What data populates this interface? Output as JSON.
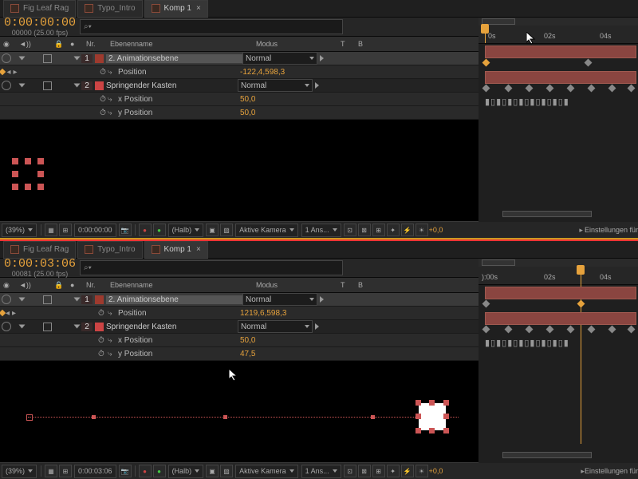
{
  "tabs": [
    {
      "label": "Fig Leaf Rag"
    },
    {
      "label": "Typo_Intro"
    },
    {
      "label": "Komp 1",
      "active": true
    }
  ],
  "top": {
    "timecode": "0:00:00:00",
    "frame": "00000 (25.00 fps)",
    "search_ph": "⌕▾",
    "colNr": "Nr.",
    "colLayer": "Ebenenname",
    "colMode": "Modus",
    "colT": "T",
    "colB": "B",
    "layer1": {
      "nr": "1",
      "name": "2. Animationsebene",
      "mode": "Normal",
      "pos_lbl": "Position",
      "pos_val": "-122,4,598,3"
    },
    "layer2": {
      "nr": "2",
      "name": "Springender Kasten",
      "mode": "Normal",
      "xp_lbl": "x Position",
      "xp_val": "50,0",
      "yp_lbl": "y Position",
      "yp_val": "50,0"
    },
    "ruler": {
      "t0": "0s",
      "t2": "02s",
      "t4": "04s"
    }
  },
  "bottom": {
    "timecode": "0:00:03:06",
    "frame": "00081 (25.00 fps)",
    "layer1": {
      "nr": "1",
      "name": "2. Animationsebene",
      "mode": "Normal",
      "pos_lbl": "Position",
      "pos_val": "1219,6,598,3"
    },
    "layer2": {
      "nr": "2",
      "name": "Springender Kasten",
      "mode": "Normal",
      "xp_lbl": "x Position",
      "xp_val": "50,0",
      "yp_lbl": "y Position",
      "yp_val": "47,5"
    },
    "ruler": {
      "t0": "):00s",
      "t2": "02s",
      "t4": "04s"
    }
  },
  "toolbar": {
    "zoom": "(39%)",
    "tc1": "0:00:00:00",
    "tc2": "0:00:03:06",
    "res": "(Halb)",
    "cam": "Aktive Kamera",
    "views": "1 Ans...",
    "exp": "+0,0",
    "flyout": "Einstellungen für"
  }
}
